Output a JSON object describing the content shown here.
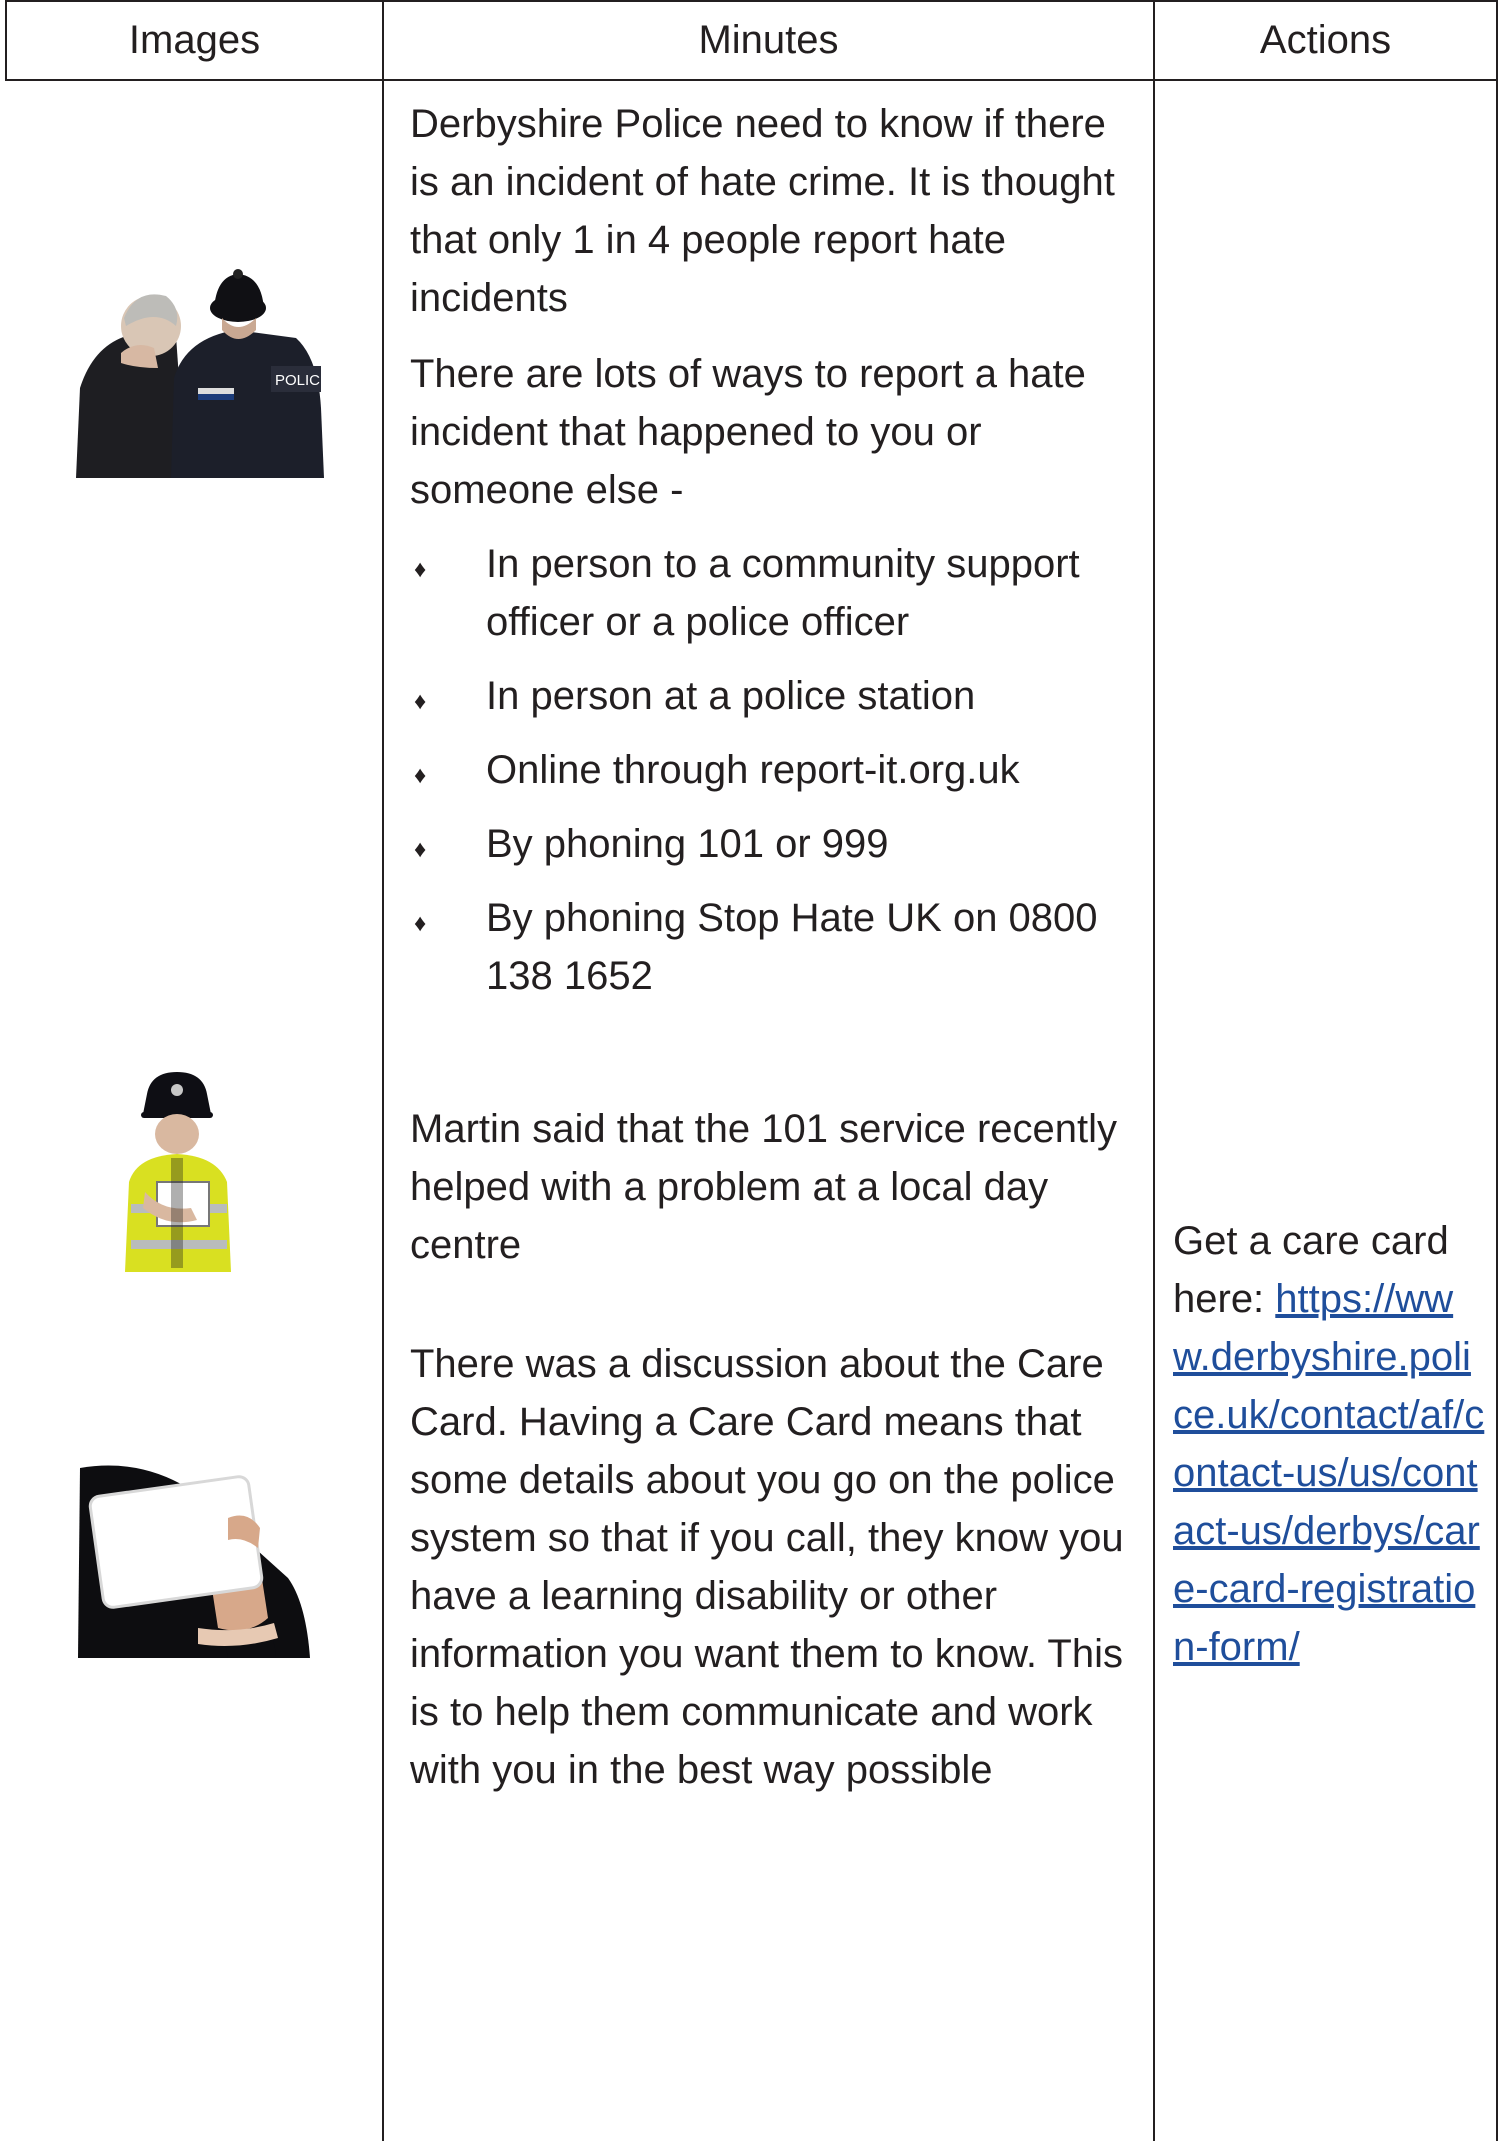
{
  "table": {
    "headers": {
      "images": "Images",
      "minutes": "Minutes",
      "actions": "Actions"
    }
  },
  "minutes": {
    "intro_1": "Derbyshire Police need to know if there is an incident of hate crime. It is thought that only 1 in 4 people report hate incidents",
    "intro_2": "There are lots of ways to report a hate incident that happened to you or someone else -",
    "ways": [
      "In person to a community support officer or a police officer",
      "In person at a police station",
      "Online through report-it.org.uk",
      "By phoning 101 or 999",
      "By phoning Stop Hate UK on 0800 138 1652"
    ],
    "martin": "Martin said that the 101 service recently helped with a problem at a local day centre",
    "care_card": "There was a discussion about the Care Card. Having a Care Card means that some details about you go on the police system so that if you call, they know you have a learning disability or other information you want them to know. This is to help them communicate and work with you in the best way possible"
  },
  "actions": {
    "care_card_text": "Get a care card here: ",
    "care_card_link": "https://www.derbyshire.police.uk/contact/af/contact-us/us/contact-us/derbys/care-card-registration-form/"
  },
  "images": {
    "police_hat": "POLICE",
    "bullet_icon": "diamond-icon"
  },
  "colors": {
    "text": "#231f20",
    "link": "#1f4e9b",
    "hivis": "#d9e021",
    "police_navy": "#1c1f2a"
  }
}
